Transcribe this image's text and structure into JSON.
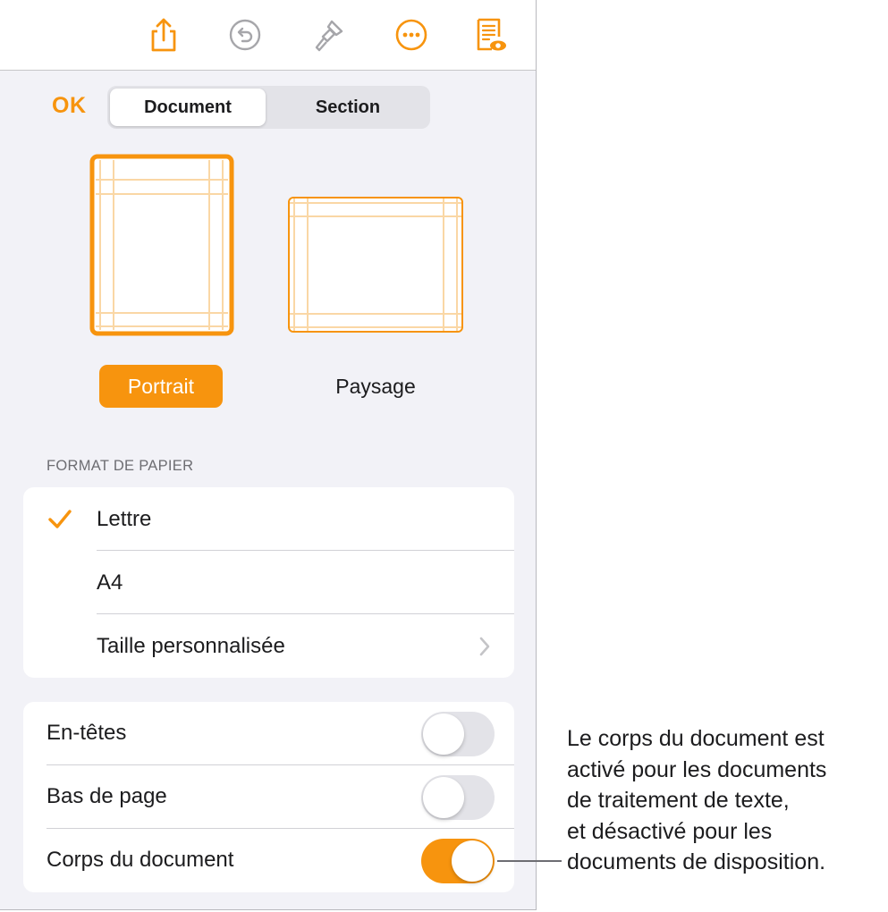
{
  "toolbar": {
    "icons": [
      "share-icon",
      "undo-icon",
      "paintbrush-icon",
      "more-icon",
      "document-setup-icon"
    ]
  },
  "header": {
    "ok_label": "OK",
    "tabs": [
      {
        "label": "Document",
        "selected": true
      },
      {
        "label": "Section",
        "selected": false
      }
    ]
  },
  "orientation": {
    "portrait_label": "Portrait",
    "landscape_label": "Paysage",
    "selected": "Portrait"
  },
  "paper_size": {
    "header": "FORMAT DE PAPIER",
    "items": [
      {
        "label": "Lettre",
        "checked": true
      },
      {
        "label": "A4",
        "checked": false
      },
      {
        "label": "Taille personnalisée",
        "checked": false
      }
    ]
  },
  "toggles": [
    {
      "label": "En-têtes",
      "on": false
    },
    {
      "label": "Bas de page",
      "on": false
    },
    {
      "label": "Corps du document",
      "on": true
    }
  ],
  "callout": {
    "lines": [
      "Le corps du document est",
      "activé pour les documents",
      "de traitement de texte,",
      "et désactivé pour les",
      "documents de disposition."
    ]
  },
  "colors": {
    "accent": "#f7940e",
    "background": "#f2f2f7",
    "card": "#ffffff",
    "toggle_off": "#e3e3e8",
    "disabled_icon": "#a6a6aa"
  }
}
